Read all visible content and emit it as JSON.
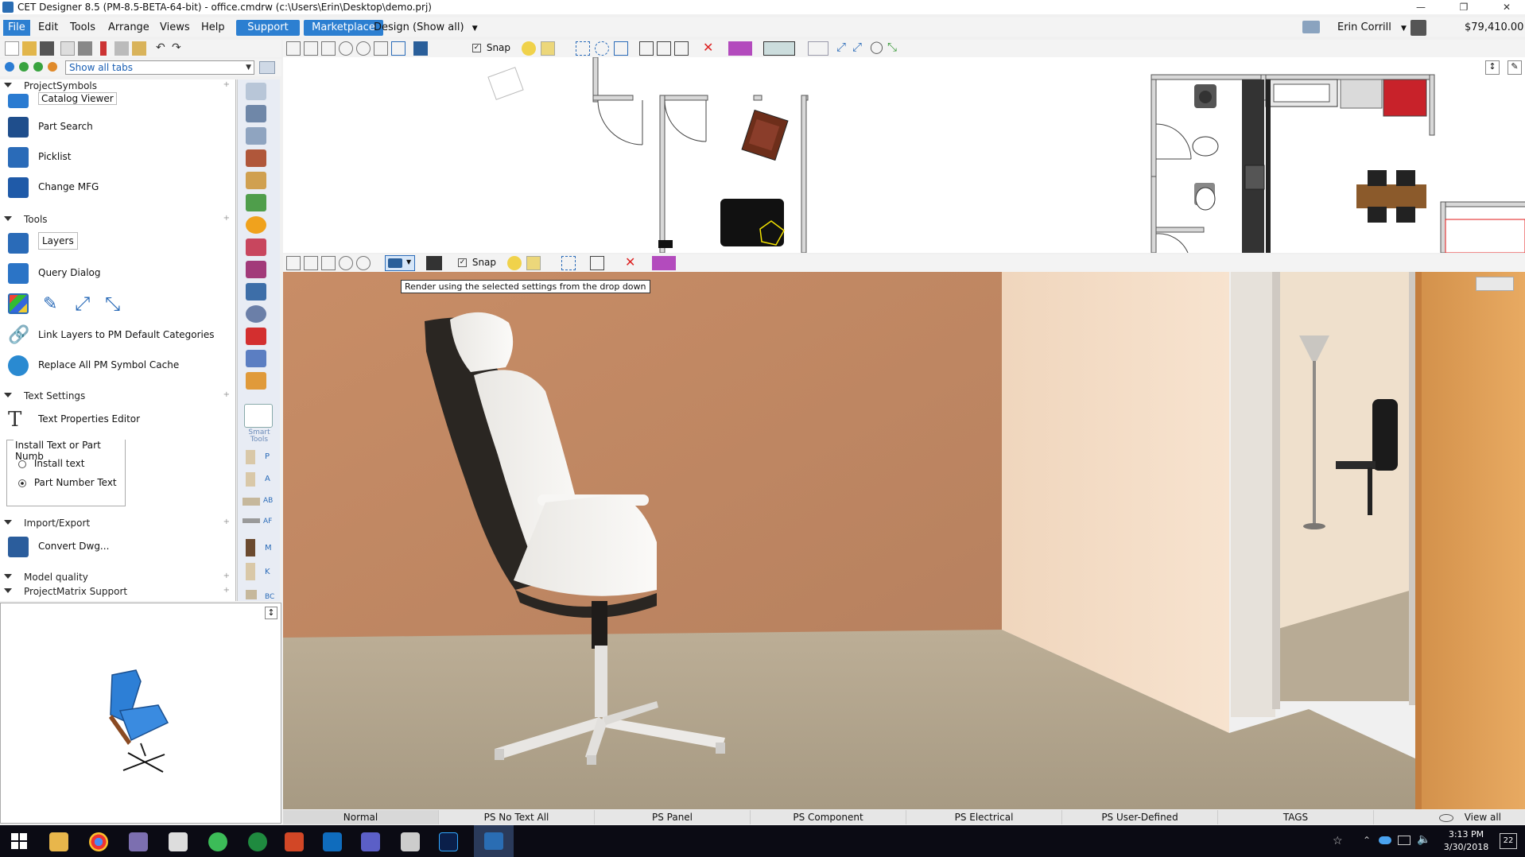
{
  "title_bar": {
    "title": "CET Designer 8.5 (PM-8.5-BETA-64-bit) - office.cmdrw (c:\\Users\\Erin\\Desktop\\demo.prj)"
  },
  "menu": {
    "items": [
      "File",
      "Edit",
      "Tools",
      "Arrange",
      "Views",
      "Help"
    ],
    "support_label": "Support",
    "marketplace_label": "Marketplace",
    "design_dropdown": "Design (Show all)",
    "user_name": "Erin Corrill",
    "price": "$79,410.00"
  },
  "left_toolbar": {
    "tabs_dropdown": "Show all tabs"
  },
  "plan_toolbar": {
    "snap_label": "Snap"
  },
  "render_toolbar": {
    "snap_label": "Snap"
  },
  "tooltip": "Render using the selected settings from the drop down",
  "sections": [
    {
      "title": "ProjectSymbols",
      "tools": [
        "Catalog Viewer",
        "Part Search",
        "Picklist",
        "Change MFG"
      ]
    },
    {
      "title": "Tools",
      "tools": [
        "Layers",
        "Query Dialog",
        "Link Layers to PM Default Categories",
        "Replace All PM Symbol Cache"
      ]
    },
    {
      "title": "Text Settings",
      "tools": [
        "Text Properties Editor"
      ]
    },
    {
      "title": "Import/Export",
      "tools": [
        "Convert Dwg..."
      ]
    },
    {
      "title": "Model quality"
    },
    {
      "title": "ProjectMatrix Support"
    }
  ],
  "install_group": {
    "title": "Install Text or Part Numb",
    "options": [
      "Install text",
      "Part Number Text"
    ],
    "selected": "Part Number Text"
  },
  "icon_strip": {
    "smart_tools_label": "Smart Tools",
    "letters": [
      "P",
      "A",
      "AB",
      "AF",
      "M",
      "K",
      "BC"
    ]
  },
  "status_bar": [
    "Normal",
    "PS No Text All",
    "PS Panel",
    "PS Component",
    "PS Electrical",
    "PS User-Defined",
    "TAGS",
    "View all"
  ],
  "taskbar": {
    "time": "3:13 PM",
    "date": "3/30/2018",
    "notification_count": "22"
  },
  "colors": {
    "accent": "#2c7fd1",
    "wall": "#c4916b",
    "floor": "#b9a990",
    "chair_dark": "#2a2622",
    "chair_light": "#f4f2ef"
  }
}
